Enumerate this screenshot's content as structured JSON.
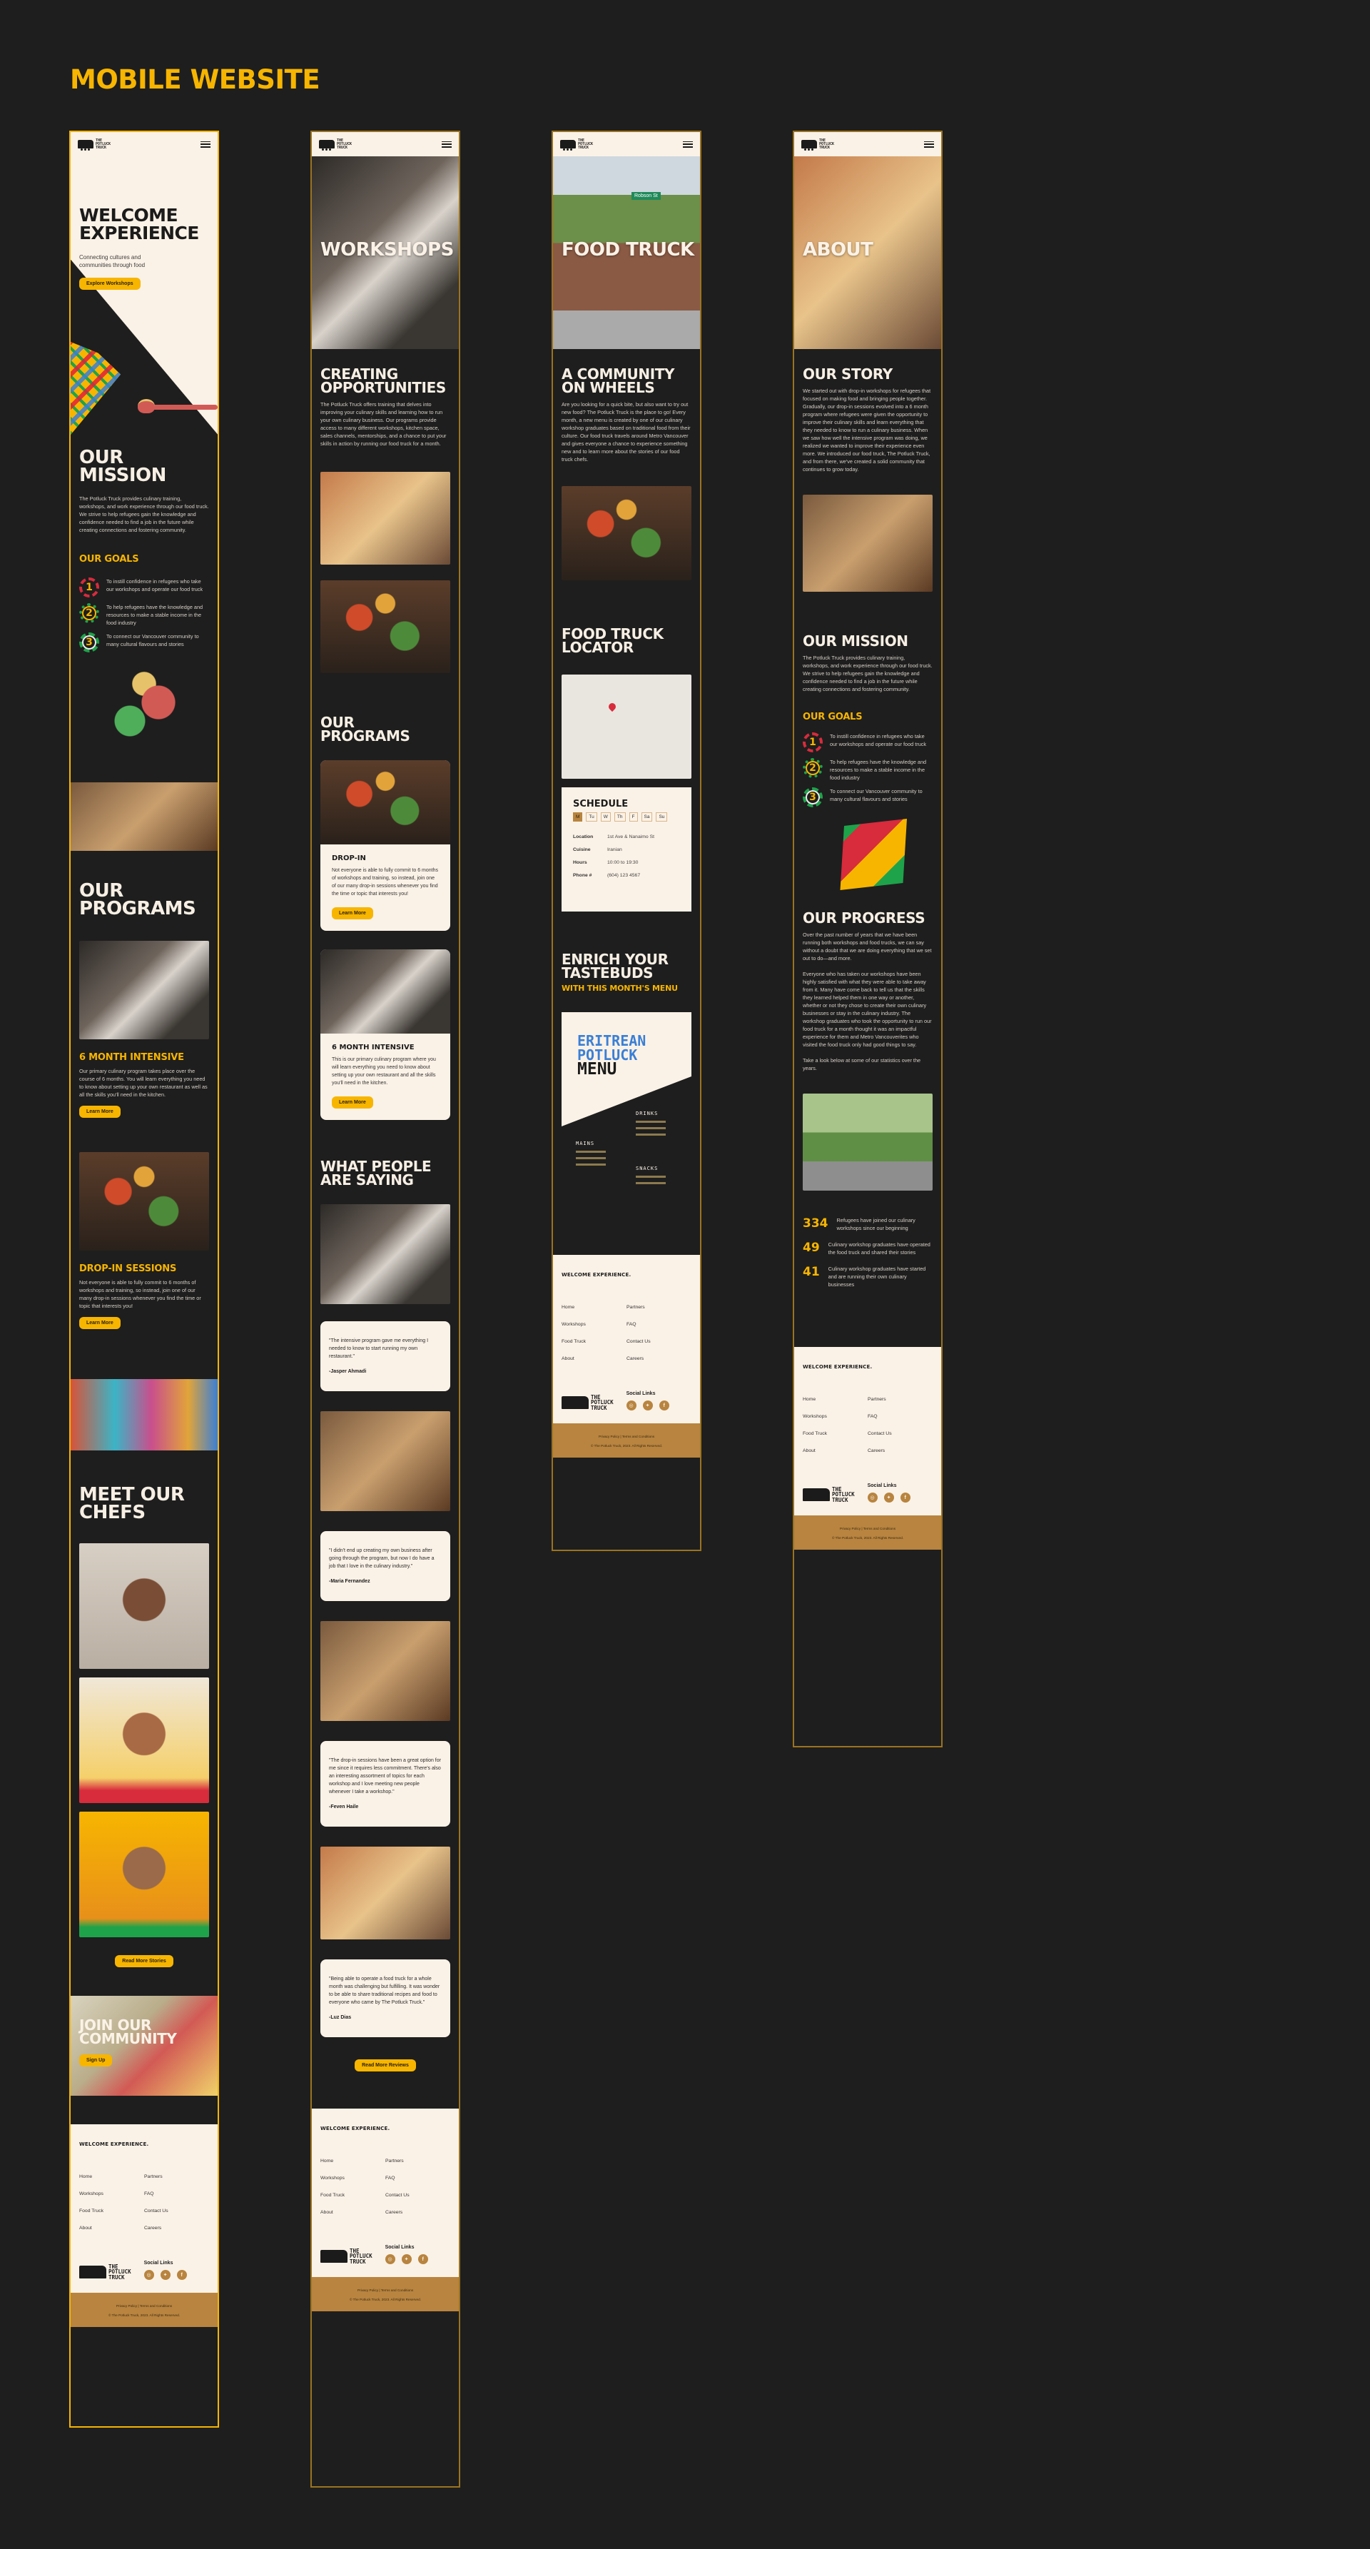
{
  "page_title": "MOBILE WEBSITE",
  "brand": {
    "logo_text": [
      "THE",
      "POTLUCK",
      "TRUCK"
    ],
    "colors": {
      "gold": "#f7b500",
      "cream": "#fbf2e7",
      "dark": "#1e1e1e",
      "tan": "#b8843f"
    }
  },
  "footer": {
    "title": "WELCOME EXPERIENCE.",
    "links_left": [
      "Home",
      "Workshops",
      "Food Truck",
      "About"
    ],
    "links_right": [
      "Partners",
      "FAQ",
      "Contact Us",
      "Careers"
    ],
    "social_label": "Social Links",
    "socials": [
      "instagram-icon",
      "twitter-icon",
      "facebook-icon"
    ],
    "legal": "Privacy Policy | Terms and Conditions",
    "copyright": "© The Potluck Truck, 2023. All Rights Reserved."
  },
  "home": {
    "hero_title_1": "WELCOME",
    "hero_title_2": "EXPERIENCE",
    "hero_subtitle": "Connecting cultures and communities through food",
    "hero_button": "Explore Workshops",
    "mission_title_1": "OUR",
    "mission_title_2": "MISSION",
    "mission_text": "The Potluck Truck provides culinary training, workshops, and work experience through our food truck. We strive to help refugees gain the knowledge and confidence needed to find a job in the future while creating connections and fostering community.",
    "goals_title": "OUR GOALS",
    "goals": [
      {
        "num": "1",
        "text": "To instill confidence in refugees who take our workshops and operate our food truck"
      },
      {
        "num": "2",
        "text": "To help refugees have the knowledge and resources to make a stable income in the food industry"
      },
      {
        "num": "3",
        "text": "To connect our Vancouver community to many cultural flavours and stories"
      }
    ],
    "programs_title_1": "OUR",
    "programs_title_2": "PROGRAMS",
    "programs": [
      {
        "title": "6 MONTH INTENSIVE",
        "text": "Our primary culinary program takes place over the course of 6 months. You will learn everything you need to know about setting up your own restaurant as well as all the skills you'll need in the kitchen.",
        "button": "Learn More"
      },
      {
        "title": "DROP-IN SESSIONS",
        "text": "Not everyone is able to fully commit to 6 months of workshops and training, so instead, join one of our many drop-in sessions whenever you find the time or topic that interests you!",
        "button": "Learn More"
      }
    ],
    "chefs_title_1": "MEET OUR",
    "chefs_title_2": "CHEFS",
    "chefs_button": "Read More Stories",
    "community_title_1": "JOIN OUR",
    "community_title_2": "COMMUNITY",
    "community_button": "Sign Up"
  },
  "workshops": {
    "hero_label": "WORKSHOPS",
    "intro_title_1": "CREATING",
    "intro_title_2": "OPPORTUNITIES",
    "intro_text": "The Potluck Truck offers training that delves into improving your culinary skills and learning how to run your own culinary business. Our programs provide access to many different workshops, kitchen space, sales channels, mentorships, and a chance to put your skills in action by running our food truck for a month.",
    "programs_title_1": "OUR",
    "programs_title_2": "PROGRAMS",
    "cards": [
      {
        "title": "DROP-IN",
        "text": "Not everyone is able to fully commit to 6 months of workshops and training, so instead, join one of our many drop-in sessions whenever you find the time or topic that interests you!",
        "button": "Learn More"
      },
      {
        "title": "6 MONTH INTENSIVE",
        "text": "This is our primary culinary program where you will learn everything you need to know about setting up your own restaurant and all the skills you'll need in the kitchen.",
        "button": "Learn More"
      }
    ],
    "reviews_title_1": "WHAT PEOPLE",
    "reviews_title_2": "ARE SAYING",
    "reviews": [
      {
        "quote": "\"The intensive program gave me everything I needed to know to start running my own restaurant.\"",
        "author": "-Jasper Ahmadi"
      },
      {
        "quote": "\"I didn't end up creating my own business after going through the program, but now I do have a job that I love in the culinary industry.\"",
        "author": "-Maria Fernandez"
      },
      {
        "quote": "\"The drop-in sessions have been a great option for me since it requires less commitment. There's also an interesting assortment of topics for each workshop and I love meeting new people whenever I take a workshop.\"",
        "author": "-Feven Haile"
      },
      {
        "quote": "\"Being able to operate a food truck for a whole month was challenging but fulfilling. It was wonder to be able to share traditional recipes and food to everyone who came by The Potluck Truck.\"",
        "author": "-Luz Dias"
      }
    ],
    "reviews_button": "Read More Reviews"
  },
  "foodtruck": {
    "hero_label": "FOOD TRUCK",
    "street_sign": "Robson St",
    "intro_title_1": "A COMMUNITY",
    "intro_title_2": "ON WHEELS",
    "intro_text": "Are you looking for a quick bite, but also want to try out new food? The Potluck Truck is the place to go! Every month, a new menu is created by one of our culinary workshop graduates based on traditional food from their culture. Our food truck travels around Metro Vancouver and gives everyone a chance to experience something new and to learn more about the stories of our food truck chefs.",
    "locator_title_1": "FOOD TRUCK",
    "locator_title_2": "LOCATOR",
    "schedule": {
      "title": "SCHEDULE",
      "days": [
        "M",
        "Tu",
        "W",
        "Th",
        "F",
        "Sa",
        "Su"
      ],
      "active_day": "M",
      "rows": [
        {
          "key": "Location",
          "value": "1st Ave & Nanaimo St"
        },
        {
          "key": "Cuisine",
          "value": "Iranian"
        },
        {
          "key": "Hours",
          "value": "10:00 to 19:30"
        },
        {
          "key": "Phone #",
          "value": "(604) 123 4567"
        }
      ]
    },
    "menu_title_1": "ENRICH YOUR",
    "menu_title_2": "TASTEBUDS",
    "menu_subtitle": "WITH THIS MONTH'S MENU",
    "menu_card": {
      "line1": "ERITREAN",
      "line2": "POTLUCK",
      "line3": "MENU",
      "sections": [
        "DRINKS",
        "MAINS",
        "SNACKS"
      ]
    }
  },
  "about": {
    "hero_label": "ABOUT",
    "story_title": "OUR STORY",
    "story_text": "We started out with drop-in workshops for refugees that focused on making food and bringing people together. Gradually, our drop-in sessions evolved into a 6 month program where refugees were given the opportunity to improve their culinary skills and learn everything that they needed to know to run a culinary business. When we saw how well the intensive program was doing, we realized we wanted to improve their experience even more. We introduced our food truck, The Potluck Truck, and from there, we've created a solid community that continues to grow today.",
    "mission_title": "OUR MISSION",
    "mission_text": "The Potluck Truck provides culinary training, workshops, and work experience through our food truck. We strive to help refugees gain the knowledge and confidence needed to find a job in the future while creating connections and fostering community.",
    "goals_title": "OUR GOALS",
    "progress_title": "OUR PROGRESS",
    "progress_p1": "Over the past number of years that we have been running both workshops and food trucks, we can say without a doubt that we are doing everything that we set out to do—and more.",
    "progress_p2": "Everyone who has taken our workshops have been highly satisfied with what they were able to take away from it. Many have come back to tell us that the skills they learned helped them in one way or another, whether or not they chose to create their own culinary businesses or stay in the culinary industry. The workshop graduates who took the opportunity to run our food truck for a month thought it was an impactful experience for them and Metro Vancouverites who visited the food truck only had good things to say.",
    "progress_p3": "Take a look below at some of our statistics over the years.",
    "stats": [
      {
        "num": "334",
        "text": "Refugees have joined our culinary workshops since our beginning"
      },
      {
        "num": "49",
        "text": "Culinary workshop graduates have operated the food truck and shared their stories"
      },
      {
        "num": "41",
        "text": "Culinary workshop graduates have started and are running their own culinary businesses"
      }
    ]
  }
}
